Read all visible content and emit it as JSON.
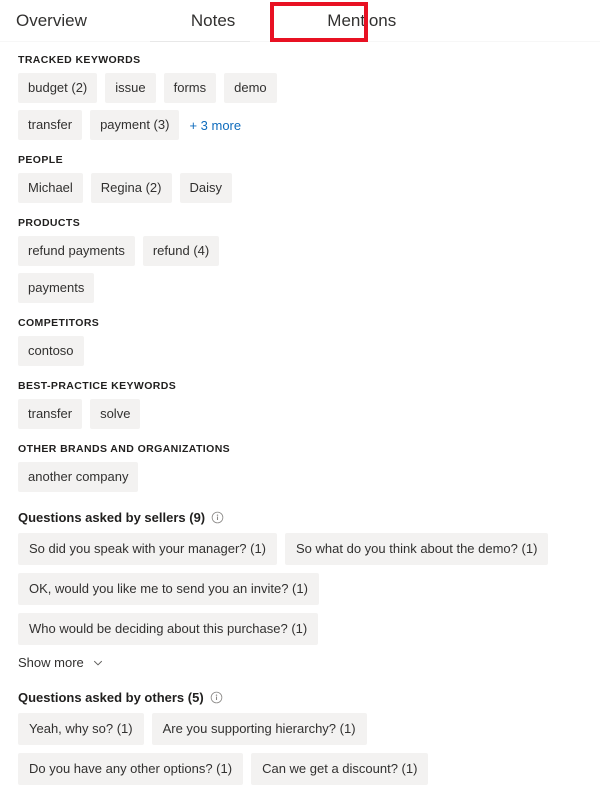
{
  "tabs": [
    {
      "label": "Overview",
      "selected": false
    },
    {
      "label": "Notes",
      "selected": false
    },
    {
      "label": "Mentions",
      "selected": true
    }
  ],
  "highlight": {
    "color": "#e81123",
    "target": "Mentions"
  },
  "colors": {
    "chip_bg": "#f3f2f1",
    "link": "#0f6cbd",
    "text": "#201f1e",
    "highlight": "#e81123"
  },
  "sections": [
    {
      "header": "TRACKED KEYWORDS",
      "chips": [
        "budget (2)",
        "issue",
        "forms",
        "demo",
        "transfer",
        "payment (3)"
      ],
      "more_link": "+ 3 more"
    },
    {
      "header": "PEOPLE",
      "chips": [
        "Michael",
        "Regina (2)",
        "Daisy"
      ],
      "more_link": null
    },
    {
      "header": "PRODUCTS",
      "chips": [
        "refund payments",
        "refund (4)",
        "payments"
      ],
      "more_link": null
    },
    {
      "header": "COMPETITORS",
      "chips": [
        "contoso"
      ],
      "more_link": null
    },
    {
      "header": "BEST-PRACTICE KEYWORDS",
      "chips": [
        "transfer",
        "solve"
      ],
      "more_link": null
    },
    {
      "header": "OTHER BRANDS AND ORGANIZATIONS",
      "chips": [
        "another company"
      ],
      "more_link": null
    }
  ],
  "question_blocks": [
    {
      "title": "Questions asked by sellers (9)",
      "info_icon": "info-icon",
      "questions": [
        "So did you speak with your manager? (1)",
        "So what do you think about the demo? (1)",
        "OK, would you like me to send you an invite? (1)",
        "Who would be deciding about this purchase? (1)"
      ],
      "show_more_label": "Show more",
      "show_more_icon": "chevron-down-icon"
    },
    {
      "title": "Questions asked by others (5)",
      "info_icon": "info-icon",
      "questions": [
        "Yeah, why so? (1)",
        "Are you supporting hierarchy? (1)",
        "Do you have any other options? (1)",
        "Can we get a discount? (1)"
      ],
      "show_more_label": null,
      "show_more_icon": null
    }
  ]
}
